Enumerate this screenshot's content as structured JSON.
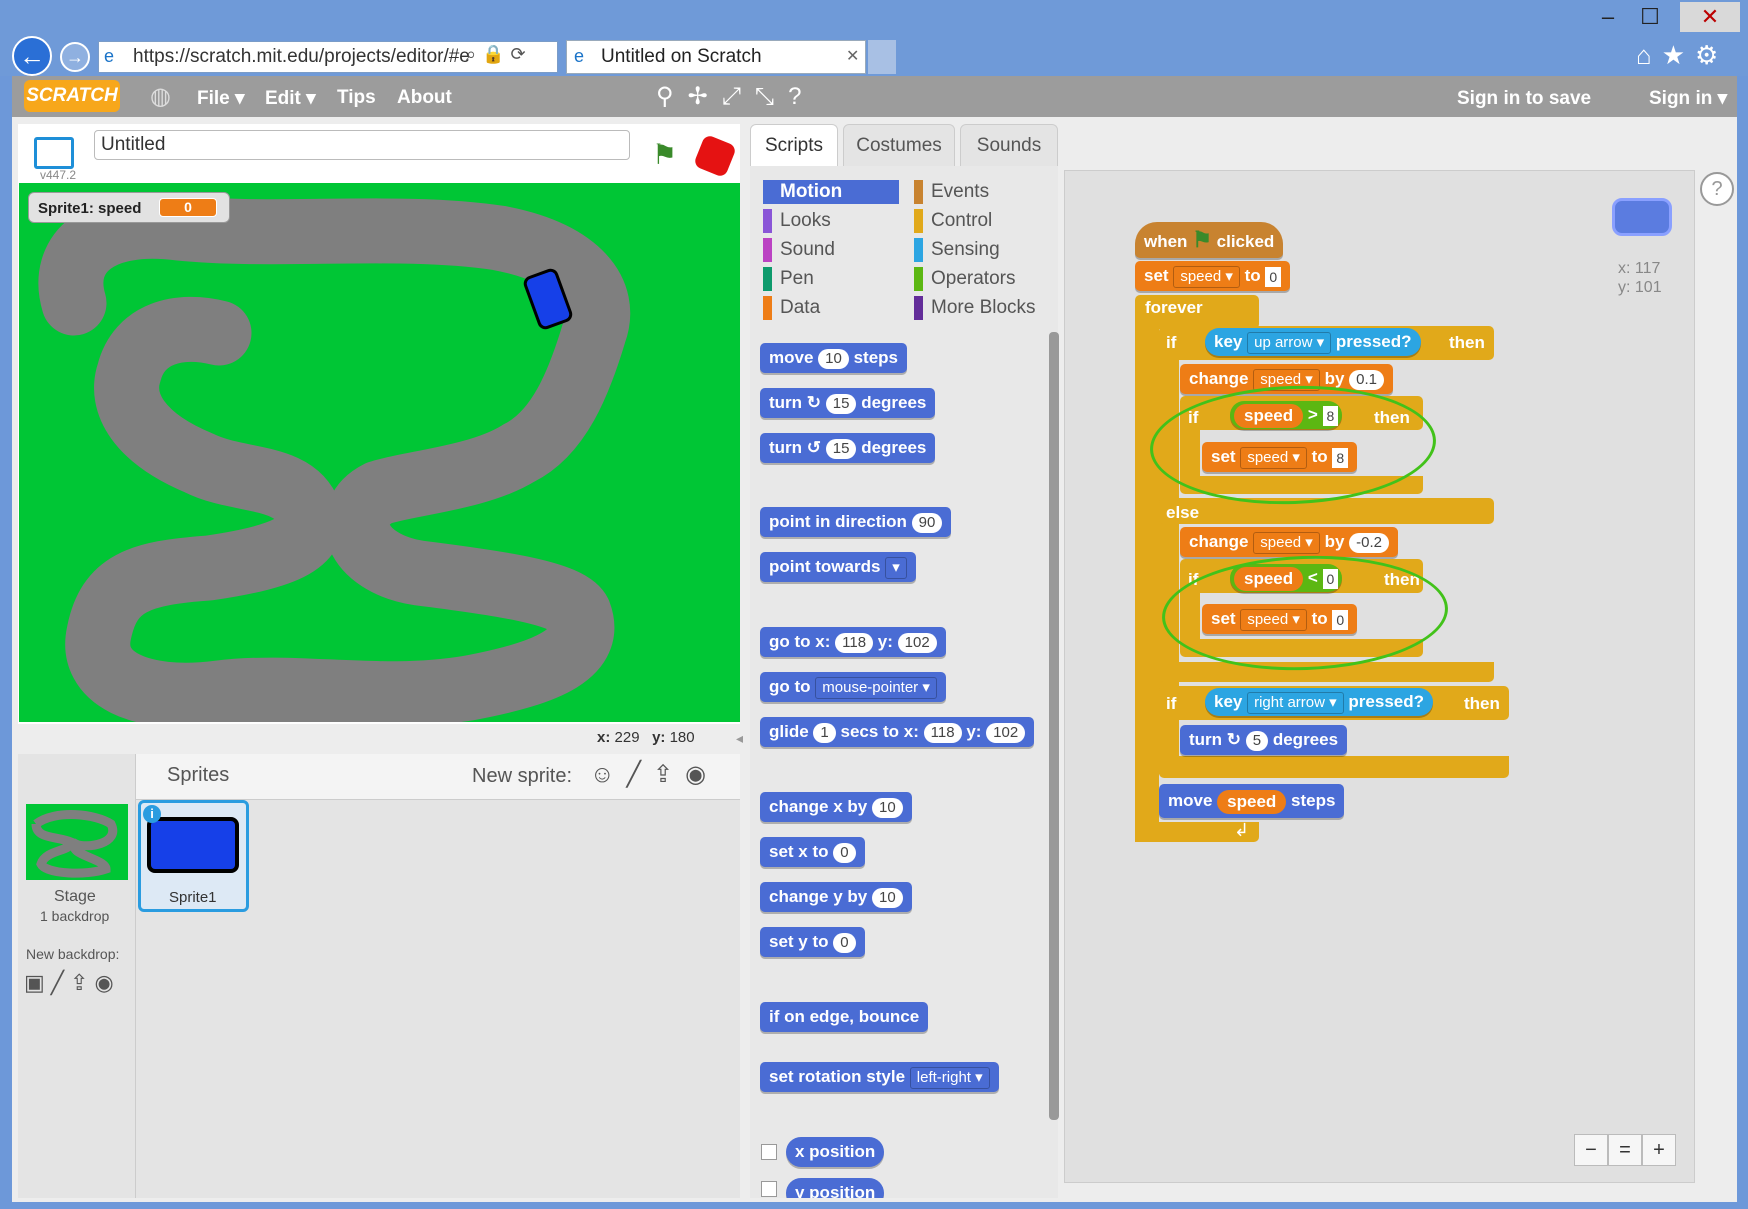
{
  "browser": {
    "url": "https://scratch.mit.edu/projects/editor/#e",
    "tab_title": "Untitled on Scratch"
  },
  "menubar": {
    "logo": "SCRATCH",
    "file": "File ▾",
    "edit": "Edit ▾",
    "tips": "Tips",
    "about": "About",
    "sign_in_to_save": "Sign in to save",
    "sign_in": "Sign in ▾"
  },
  "stage": {
    "project_title": "Untitled",
    "version": "v447.2",
    "monitor_label": "Sprite1: speed",
    "monitor_value": "0",
    "mouse_x_label": "x:",
    "mouse_x": "229",
    "mouse_y_label": "y:",
    "mouse_y": "180"
  },
  "sprites": {
    "header": "Sprites",
    "new_sprite": "New sprite:",
    "stage_label": "Stage",
    "stage_sub": "1 backdrop",
    "new_backdrop": "New backdrop:",
    "sprite1": "Sprite1"
  },
  "tabs": [
    "Scripts",
    "Costumes",
    "Sounds"
  ],
  "categories": {
    "left": [
      "Motion",
      "Looks",
      "Sound",
      "Pen",
      "Data"
    ],
    "right": [
      "Events",
      "Control",
      "Sensing",
      "Operators",
      "More Blocks"
    ]
  },
  "palette": {
    "move": "move",
    "move_n": "10",
    "steps": "steps",
    "turn": "turn",
    "turn_n": "15",
    "degrees": "degrees",
    "point_dir": "point in direction",
    "dir_n": "90",
    "point_towards": "point towards",
    "goto": "go to x:",
    "gx": "118",
    "y": "y:",
    "gy": "102",
    "goto2": "go to",
    "mouse_pointer": "mouse-pointer",
    "glide": "glide",
    "glide_n": "1",
    "secs_to_x": "secs to x:",
    "change_x": "change x by",
    "cx": "10",
    "set_x": "set x to",
    "sx": "0",
    "change_y": "change y by",
    "cy": "10",
    "set_y": "set y to",
    "sy": "0",
    "bounce": "if on edge, bounce",
    "rotation": "set rotation style",
    "rotation_v": "left-right",
    "x_position": "x position",
    "y_position": "y position"
  },
  "script": {
    "when": "when",
    "clicked": "clicked",
    "set": "set",
    "speed": "speed",
    "to": "to",
    "zero": "0",
    "forever": "forever",
    "if": "if",
    "key": "key",
    "up_arrow": "up arrow",
    "pressed": "pressed?",
    "then": "then",
    "change": "change",
    "by": "by",
    "inc": "0.1",
    "gt": ">",
    "eight": "8",
    "lt": "<",
    "else": "else",
    "dec": "-0.2",
    "right_arrow": "right arrow",
    "turn": "turn",
    "five": "5",
    "degrees": "degrees",
    "move": "move",
    "steps": "steps",
    "sprite_x": "x: 117",
    "sprite_y": "y: 101"
  }
}
